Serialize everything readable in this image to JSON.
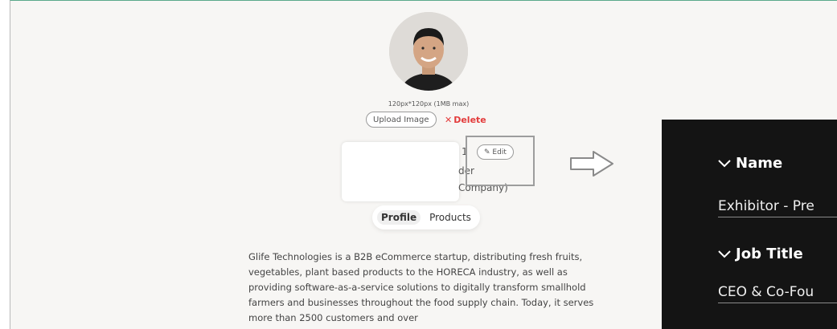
{
  "profile": {
    "image_size_hint": "120px*120px (1MB max)",
    "upload_label": "Upload Image",
    "delete_label": "Delete",
    "edit_label": "Edit",
    "partial_name_char": "1",
    "partial_job_text": "der",
    "partial_company_text": "Company)"
  },
  "tabs": [
    {
      "label": "Profile",
      "active": true
    },
    {
      "label": "Products",
      "active": false
    }
  ],
  "description": "Glife Technologies is a B2B eCommerce startup, distributing fresh fruits, vegetables, plant based products to the HORECA industry, as well as providing software-as-a-service solutions to digitally transform smallhold farmers and businesses throughout the food supply chain. Today, it serves more than 2500 customers and over",
  "edit_panel": {
    "fields": [
      {
        "label": "Name",
        "value": "Exhibitor - Pre"
      },
      {
        "label": "Job Title",
        "value": "CEO & Co-Fou"
      }
    ]
  },
  "colors": {
    "delete": "#e33b3b",
    "panel_background": "#141414",
    "page_background": "#f7f6f4",
    "top_border": "#5aa88a"
  },
  "icons": [
    "chevron-down-icon",
    "pencil-icon",
    "close-icon",
    "arrow-right-icon"
  ]
}
